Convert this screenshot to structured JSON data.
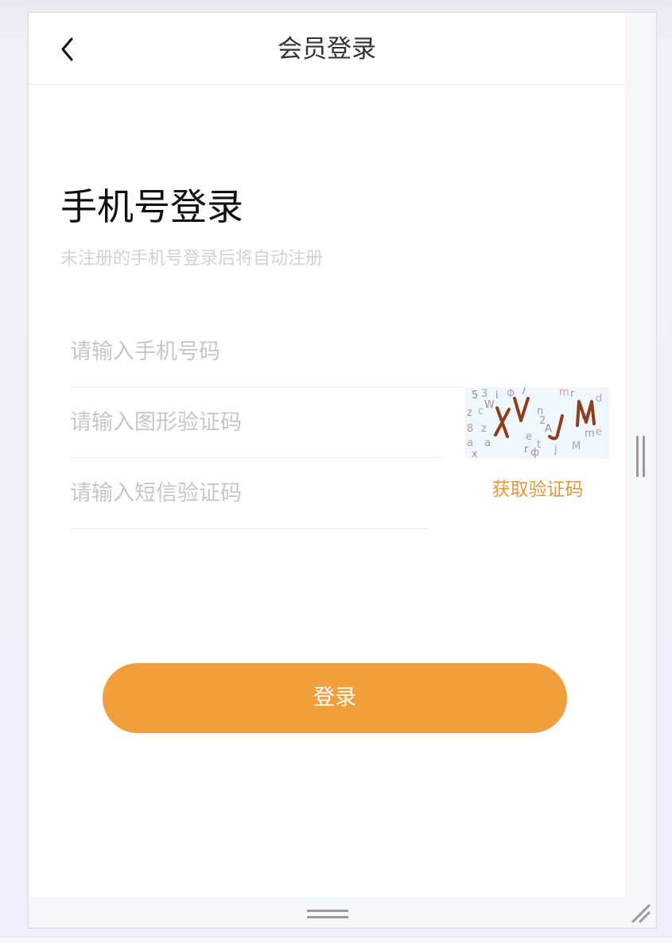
{
  "navbar": {
    "title": "会员登录",
    "back_icon": "chevron-left-icon"
  },
  "login": {
    "heading": "手机号登录",
    "subheading": "未注册的手机号登录后将自动注册",
    "phone_placeholder": "请输入手机号码",
    "phone_value": "",
    "captcha_placeholder": "请输入图形验证码",
    "captcha_value": "",
    "captcha_image_text": "XVJM",
    "sms_placeholder": "请输入短信验证码",
    "sms_value": "",
    "sms_button_label": "获取验证码",
    "submit_label": "登录"
  },
  "colors": {
    "accent": "#f19f3c",
    "link": "#e4973a",
    "placeholder": "#c6c6c6",
    "subtext": "#d2d2d2"
  }
}
